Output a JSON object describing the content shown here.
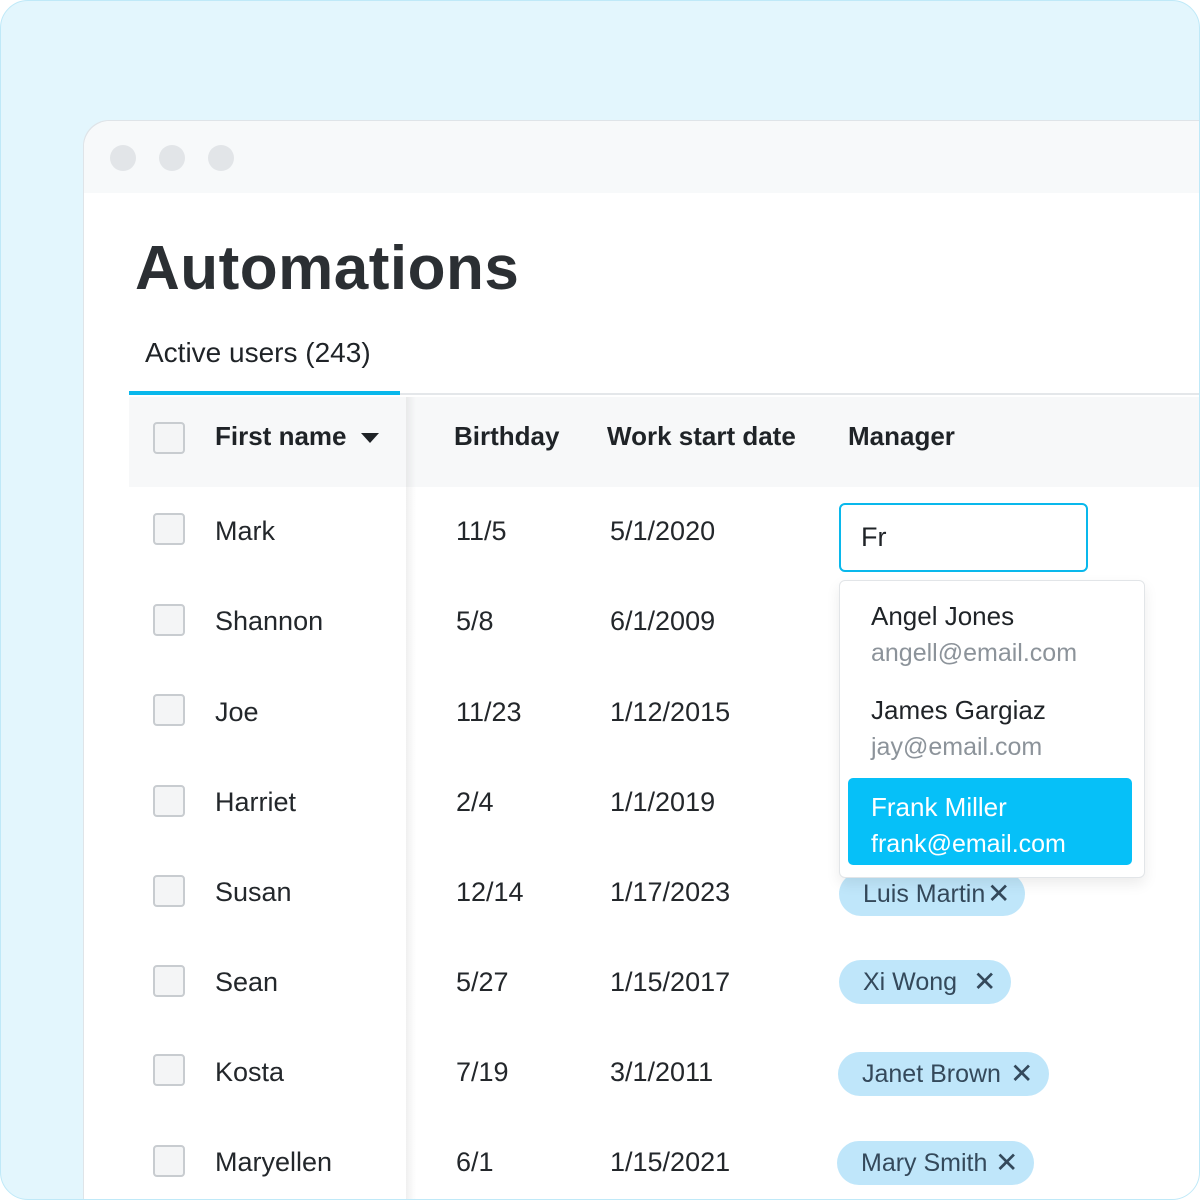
{
  "page": {
    "title": "Automations"
  },
  "tabs": [
    {
      "label": "Active users (243)"
    }
  ],
  "table": {
    "columns": [
      "First name",
      "Birthday",
      "Work start date",
      "Manager"
    ],
    "rows": [
      {
        "first_name": "Mark",
        "birthday": "11/5",
        "start_date": "5/1/2020",
        "manager": ""
      },
      {
        "first_name": "Shannon",
        "birthday": "5/8",
        "start_date": "6/1/2009",
        "manager": ""
      },
      {
        "first_name": "Joe",
        "birthday": "11/23",
        "start_date": "1/12/2015",
        "manager": ""
      },
      {
        "first_name": "Harriet",
        "birthday": "2/4",
        "start_date": "1/1/2019",
        "manager": ""
      },
      {
        "first_name": "Susan",
        "birthday": "12/14",
        "start_date": "1/17/2023",
        "manager": "Luis Martin"
      },
      {
        "first_name": "Sean",
        "birthday": "5/27",
        "start_date": "1/15/2017",
        "manager": "Xi Wong"
      },
      {
        "first_name": "Kosta",
        "birthday": "7/19",
        "start_date": "3/1/2011",
        "manager": "Janet Brown"
      },
      {
        "first_name": "Maryellen",
        "birthday": "6/1",
        "start_date": "1/15/2021",
        "manager": "Mary Smith"
      }
    ]
  },
  "manager_search": {
    "value": "Fr",
    "options": [
      {
        "name": "Angel Jones",
        "email": "angell@email.com",
        "selected": false
      },
      {
        "name": "James Gargiaz",
        "email": "jay@email.com",
        "selected": false
      },
      {
        "name": "Frank Miller",
        "email": "frank@email.com",
        "selected": true
      }
    ]
  },
  "icons": {
    "remove": "close-icon",
    "sort": "chevron-down-icon"
  },
  "colors": {
    "accent": "#06c0f8",
    "chip": "#bfe6fa",
    "text": "#23272b"
  }
}
